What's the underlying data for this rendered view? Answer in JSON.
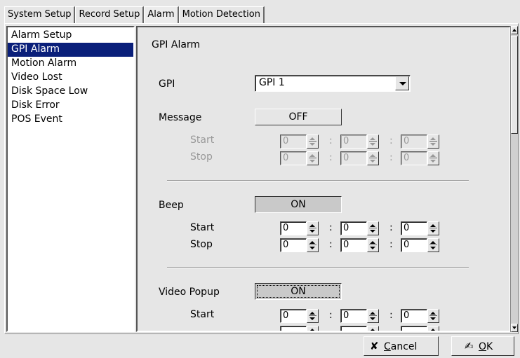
{
  "tabs": [
    {
      "label": "System Setup"
    },
    {
      "label": "Record Setup"
    },
    {
      "label": "Alarm"
    },
    {
      "label": "Motion Detection"
    }
  ],
  "sidebar": {
    "items": [
      {
        "label": "Alarm Setup"
      },
      {
        "label": "GPI Alarm"
      },
      {
        "label": "Motion Alarm"
      },
      {
        "label": "Video Lost"
      },
      {
        "label": "Disk Space Low"
      },
      {
        "label": "Disk Error"
      },
      {
        "label": "POS Event"
      }
    ],
    "selected": "GPI Alarm"
  },
  "panel": {
    "title": "GPI Alarm",
    "gpi": {
      "label": "GPI",
      "value": "GPI 1"
    },
    "message": {
      "label": "Message",
      "state": "OFF",
      "start_label": "Start",
      "stop_label": "Stop",
      "start": [
        "0",
        "0",
        "0"
      ],
      "stop": [
        "0",
        "0",
        "0"
      ]
    },
    "beep": {
      "label": "Beep",
      "state": "ON",
      "start_label": "Start",
      "stop_label": "Stop",
      "start": [
        "0",
        "0",
        "0"
      ],
      "stop": [
        "0",
        "0",
        "0"
      ]
    },
    "video_popup": {
      "label": "Video Popup",
      "state": "ON",
      "start_label": "Start",
      "start": [
        "0",
        "0",
        "0"
      ]
    },
    "sep": ":"
  },
  "footer": {
    "cancel": {
      "prefix": "",
      "accel": "C",
      "rest": "ancel"
    },
    "ok": {
      "accel": "O",
      "rest": "K"
    }
  },
  "icons": {
    "cancel": "cross-icon",
    "ok": "pen-check-icon"
  }
}
